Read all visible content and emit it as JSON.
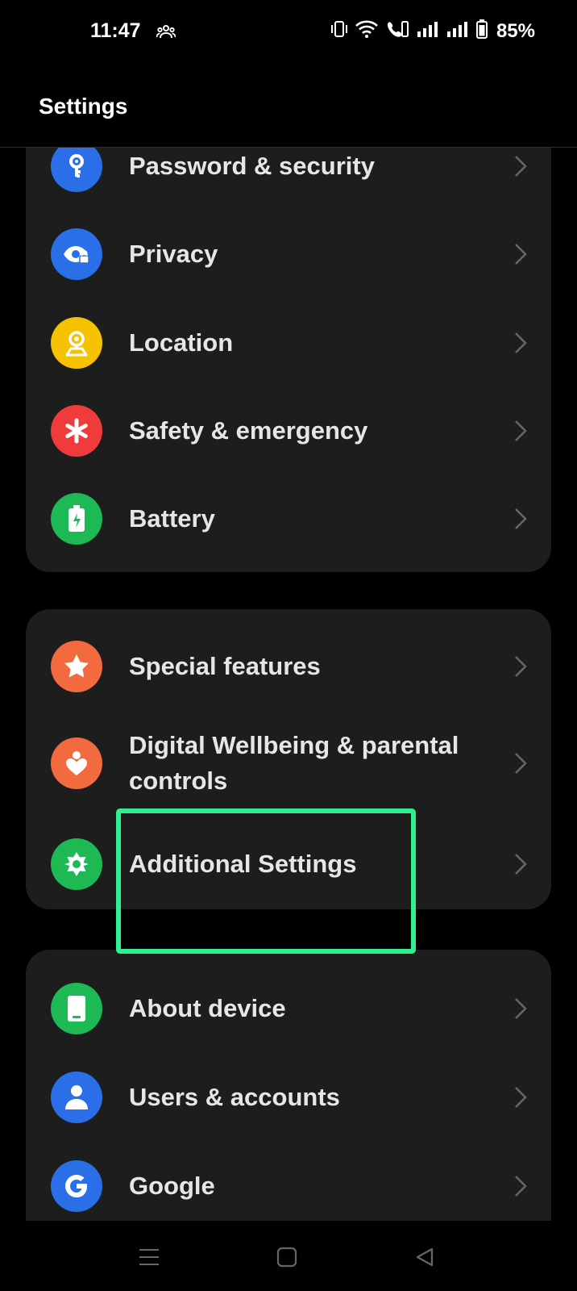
{
  "status_bar": {
    "time": "11:47",
    "battery_percent": "85%",
    "icons": [
      "people-icon",
      "vibrate-icon",
      "wifi-icon",
      "wifi-calling-icon",
      "signal-icon",
      "signal-icon",
      "battery-icon"
    ]
  },
  "header": {
    "title": "Settings"
  },
  "groups": [
    {
      "items": [
        {
          "label": "Password & security",
          "icon": "key-icon",
          "color": "#2a6fe8"
        },
        {
          "label": "Privacy",
          "icon": "privacy-eye-icon",
          "color": "#2a6fe8"
        },
        {
          "label": "Location",
          "icon": "location-pin-icon",
          "color": "#f5c100"
        },
        {
          "label": "Safety & emergency",
          "icon": "asterisk-icon",
          "color": "#ef3b3b"
        },
        {
          "label": "Battery",
          "icon": "battery-bolt-icon",
          "color": "#1db954"
        }
      ]
    },
    {
      "items": [
        {
          "label": "Special features",
          "icon": "star-icon",
          "color": "#f26a3d"
        },
        {
          "label": "Digital Wellbeing & parental controls",
          "icon": "wellbeing-heart-icon",
          "color": "#f26a3d"
        },
        {
          "label": "Additional Settings",
          "icon": "gear-star-icon",
          "color": "#1db954"
        }
      ]
    },
    {
      "items": [
        {
          "label": "About device",
          "icon": "phone-icon",
          "color": "#1db954"
        },
        {
          "label": "Users & accounts",
          "icon": "user-icon",
          "color": "#2a6fe8"
        },
        {
          "label": "Google",
          "icon": "google-icon",
          "color": "#2a6fe8"
        }
      ]
    }
  ],
  "highlight": {
    "target": "Additional Settings",
    "color": "#2ef090"
  },
  "nav_bar": {
    "buttons": [
      "menu-icon",
      "home-icon",
      "back-icon"
    ]
  }
}
